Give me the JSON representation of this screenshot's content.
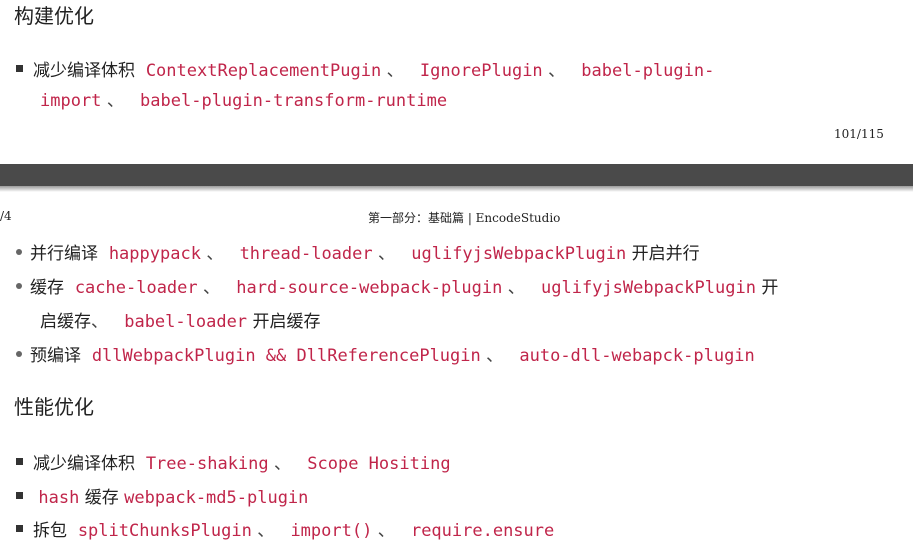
{
  "top": {
    "heading": "构建优化",
    "bullet1": {
      "text": "减少编译体积",
      "codes": [
        "ContextReplacementPugin",
        "IgnorePlugin",
        "babel-plugin-"
      ],
      "codes_line2": [
        "import",
        "babel-plugin-transform-runtime"
      ],
      "separator": "、"
    },
    "page_number": "101/115"
  },
  "bottom": {
    "left_fragment": "/4",
    "running_header": "第一部分：基础篇 | EncodeStudio",
    "list1": [
      {
        "label": "并行编译",
        "codes": [
          "happypack",
          "thread-loader",
          "uglifyjsWebpackPlugin"
        ],
        "suffix": "开启并行"
      },
      {
        "label": "缓存",
        "codes": [
          "cache-loader",
          "hard-source-webpack-plugin",
          "uglifyjsWebpackPlugin"
        ],
        "suffix": "开",
        "cont_prefix": "启缓存",
        "cont_code": "babel-loader",
        "cont_suffix": "开启缓存"
      },
      {
        "label": "预编译",
        "codes": [
          "dllWebpackPlugin && DllReferencePlugin",
          "auto-dll-webapck-plugin"
        ]
      }
    ],
    "heading": "性能优化",
    "list2": [
      {
        "label": "减少编译体积",
        "codes": [
          "Tree-shaking",
          "Scope Hositing"
        ]
      },
      {
        "codes_pre": "hash",
        "label": "缓存",
        "codes": [
          "webpack-md5-plugin"
        ]
      },
      {
        "label": "拆包",
        "codes": [
          "splitChunksPlugin",
          "import()",
          "require.ensure"
        ]
      }
    ]
  }
}
